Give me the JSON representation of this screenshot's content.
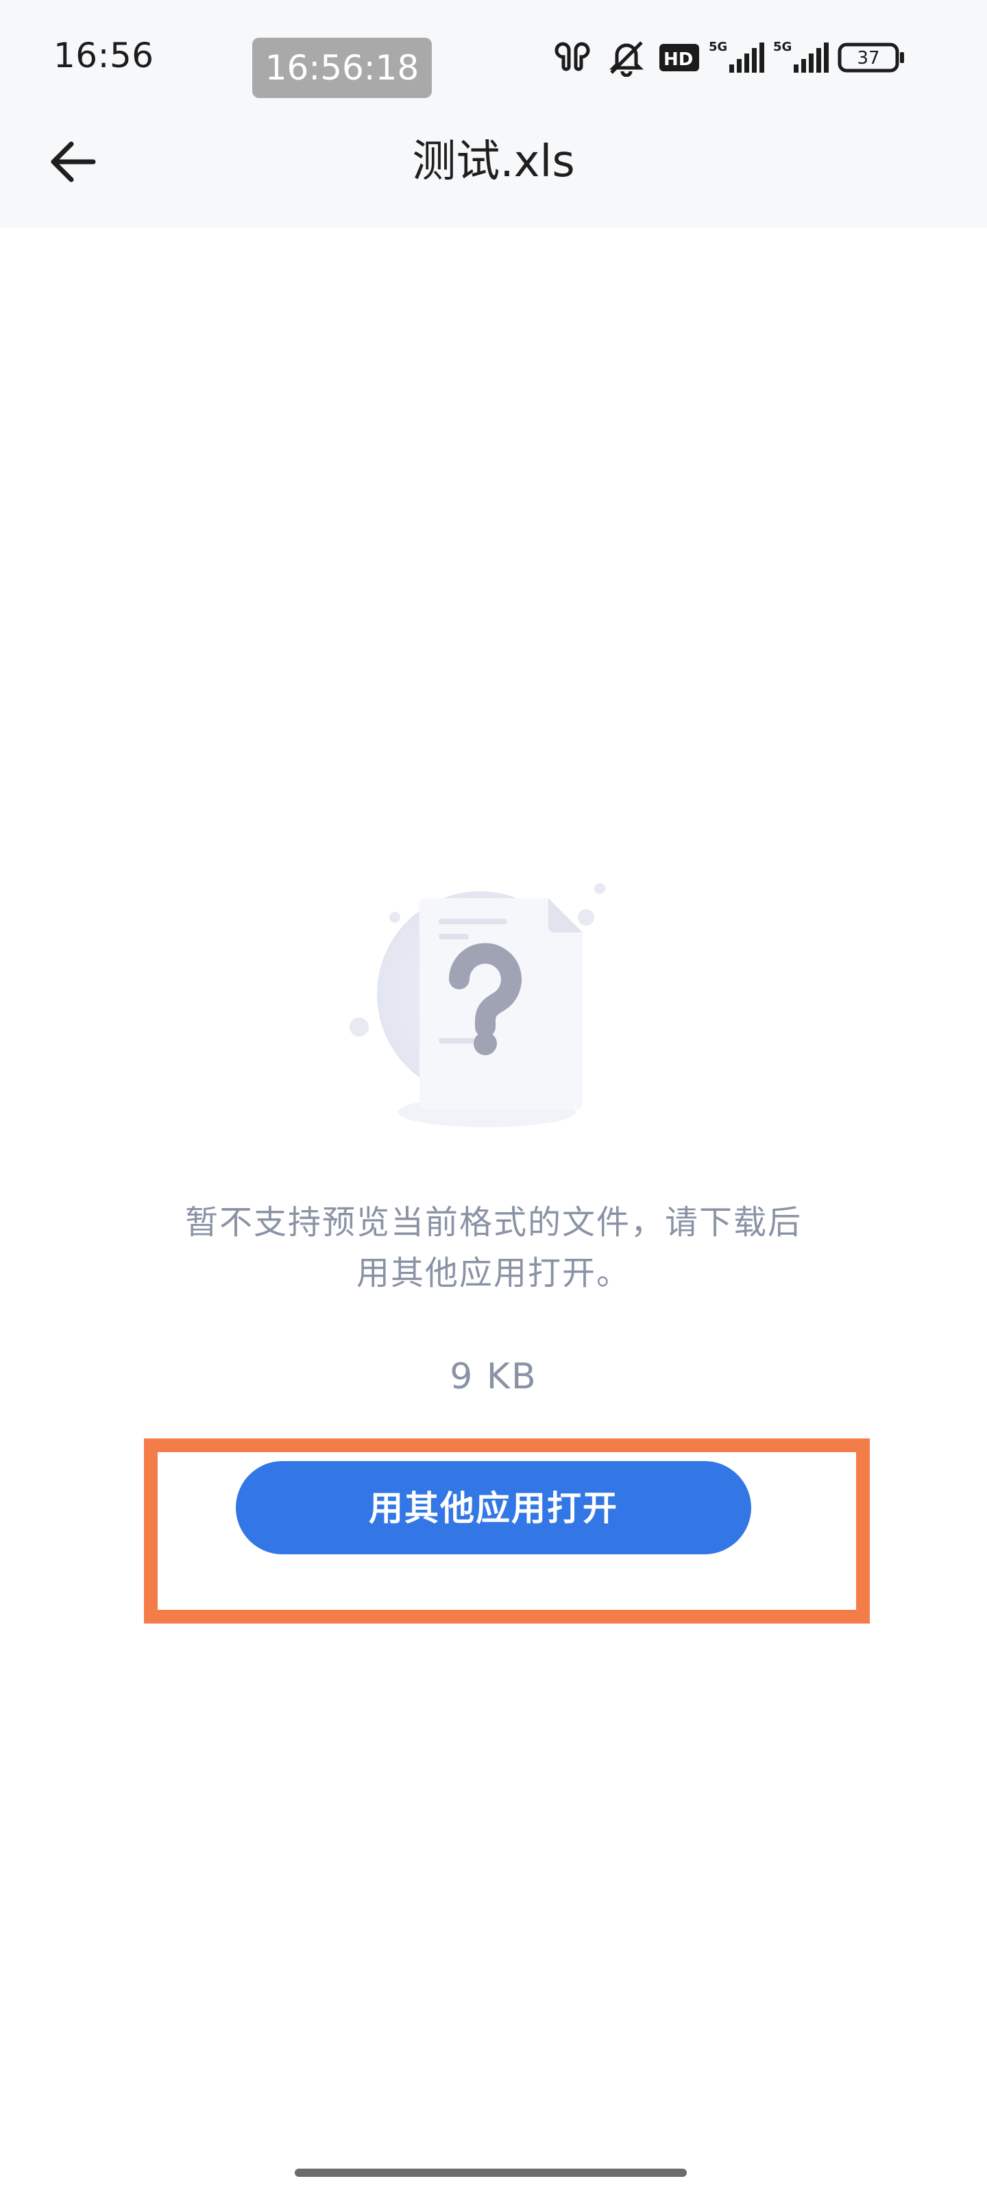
{
  "status_bar": {
    "time": "16:56",
    "clock_overlay": "16:56:18",
    "battery": "37",
    "icons": [
      "earbuds-icon",
      "mute-bell-icon",
      "hd-icon",
      "signal-5g-icon",
      "signal-5g-icon",
      "battery-icon"
    ],
    "hd_label": "HD",
    "network_label": "5G"
  },
  "nav": {
    "back_icon": "arrow-left-icon",
    "title": "测试.xls"
  },
  "empty_state": {
    "illustration": "document-question-icon",
    "message_line1": "暂不支持预览当前格式的文件，请下载后",
    "message_line2": "用其他应用打开。",
    "file_size": "9 KB"
  },
  "actions": {
    "open_with_other_app": "用其他应用打开"
  },
  "colors": {
    "primary_button": "#3277e5",
    "highlight_border": "#f47c48",
    "muted_text": "#8a93a5",
    "top_bar_bg": "#f7f8fa"
  }
}
